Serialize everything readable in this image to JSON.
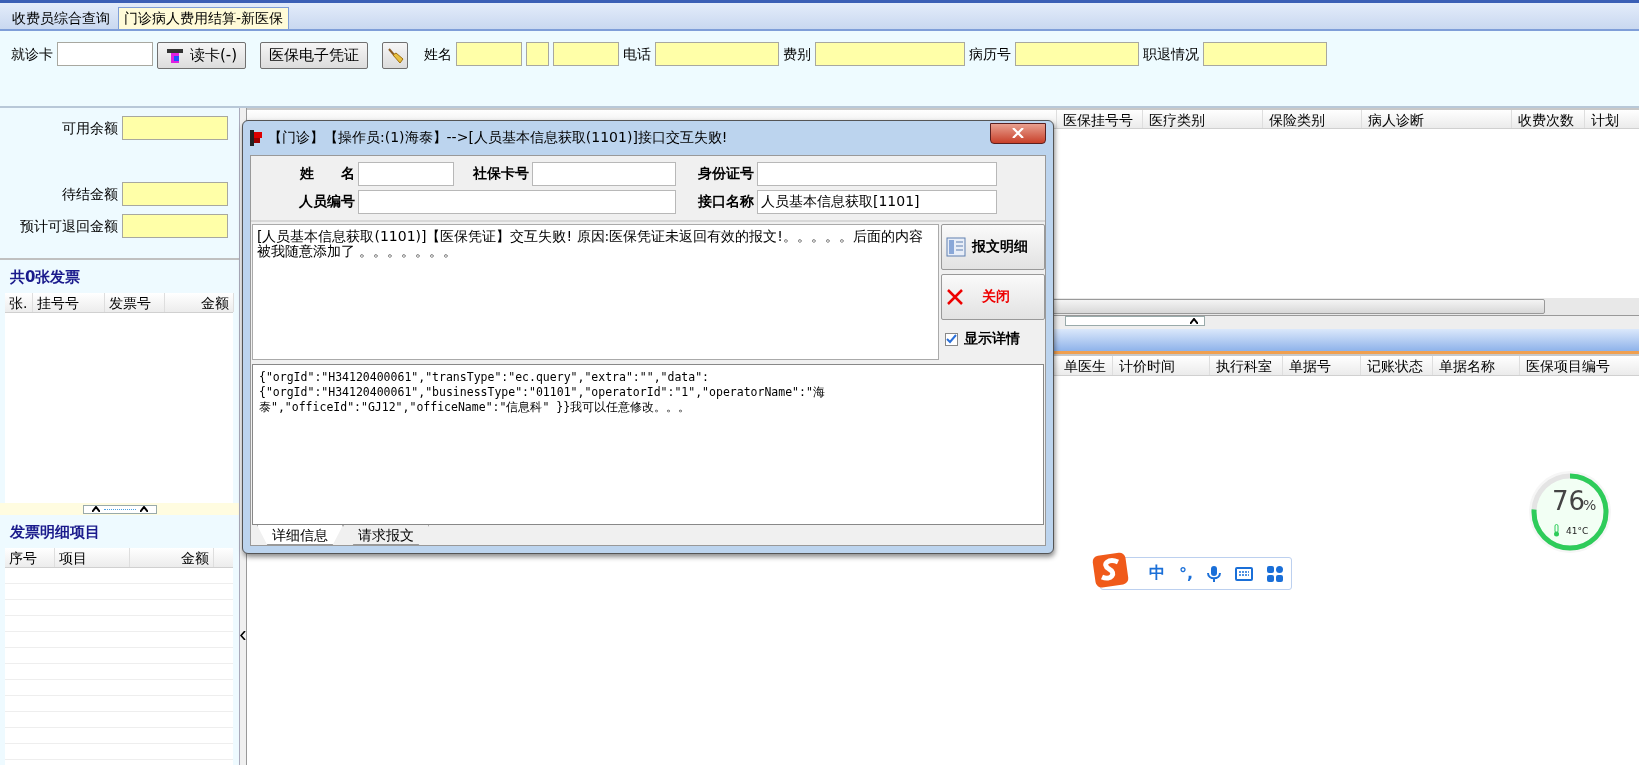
{
  "tabs": [
    {
      "label": "收费员综合查询",
      "selected": false
    },
    {
      "label": "门诊病人费用结算-新医保",
      "selected": true
    }
  ],
  "toolbar": {
    "card_label": "就诊卡",
    "read_card_button": "读卡(-)",
    "voucher_button": "医保电子凭证",
    "fields": [
      {
        "label": "姓名",
        "kind": "triple"
      },
      {
        "label": "电话",
        "kind": "medium"
      },
      {
        "label": "费别",
        "kind": "long"
      },
      {
        "label": "病历号",
        "kind": "medium"
      },
      {
        "label": "职退情况",
        "kind": "medium"
      }
    ]
  },
  "left_panel": {
    "balances": [
      {
        "label": "可用余额"
      },
      {
        "label": "待结金额"
      },
      {
        "label": "预计可退回金额"
      }
    ],
    "invoice_title": "共0张发票",
    "invoice_columns": [
      "张.",
      "挂号号",
      "发票号",
      "金额"
    ],
    "detail_title": "发票明细项目",
    "detail_columns": [
      "序号",
      "项目",
      "金额"
    ]
  },
  "visit_table": {
    "columns": [
      "医保挂号号",
      "医疗类别",
      "保险类别",
      "病人诊断",
      "收费次数",
      "计划"
    ]
  },
  "charge_table": {
    "columns": [
      "单医生",
      "计价时间",
      "执行科室",
      "单据号",
      "记账状态",
      "单据名称",
      "医保项目编号"
    ]
  },
  "dialog": {
    "title": "【门诊】【操作员:(1)海泰】-->[人员基本信息获取(1101)]接口交互失败!",
    "form": [
      {
        "label": "姓 名",
        "kind": "short"
      },
      {
        "label": "社保卡号",
        "kind": "short"
      },
      {
        "label": "身份证号",
        "kind": "short"
      },
      {
        "label": "人员编号",
        "kind": "wide"
      },
      {
        "label": "接口名称",
        "kind": "short",
        "value": "人员基本信息获取[1101]"
      }
    ],
    "message": "[人员基本信息获取(1101)]【医保凭证】交互失败! 原因:医保凭证未返回有效的报文!。。。。。后面的内容被我随意添加了 。。。。。。。",
    "detail_button": "报文明细",
    "close_button": "关闭",
    "show_details": {
      "label": "显示详情",
      "checked": true
    },
    "detail_lines": [
      "{\"orgId\":\"H34120400061\",\"transType\":\"ec.query\",\"extra\":\"\",\"data\":",
      "{\"orgId\":\"H34120400061\",\"businessType\":\"01101\",\"operatorId\":\"1\",\"operatorName\":\"海",
      "泰\",\"officeId\":\"GJ12\",\"officeName\":\"信息科\" }}我可以任意修改。。。"
    ],
    "tabs": [
      {
        "label": "详细信息",
        "selected": true
      },
      {
        "label": "请求报文",
        "selected": false
      }
    ]
  },
  "ime_bar": {
    "mode": "中",
    "punctuation": "°,"
  },
  "gauge": {
    "value": "76",
    "unit": "%",
    "temperature": "41°C",
    "level": 0.76
  }
}
